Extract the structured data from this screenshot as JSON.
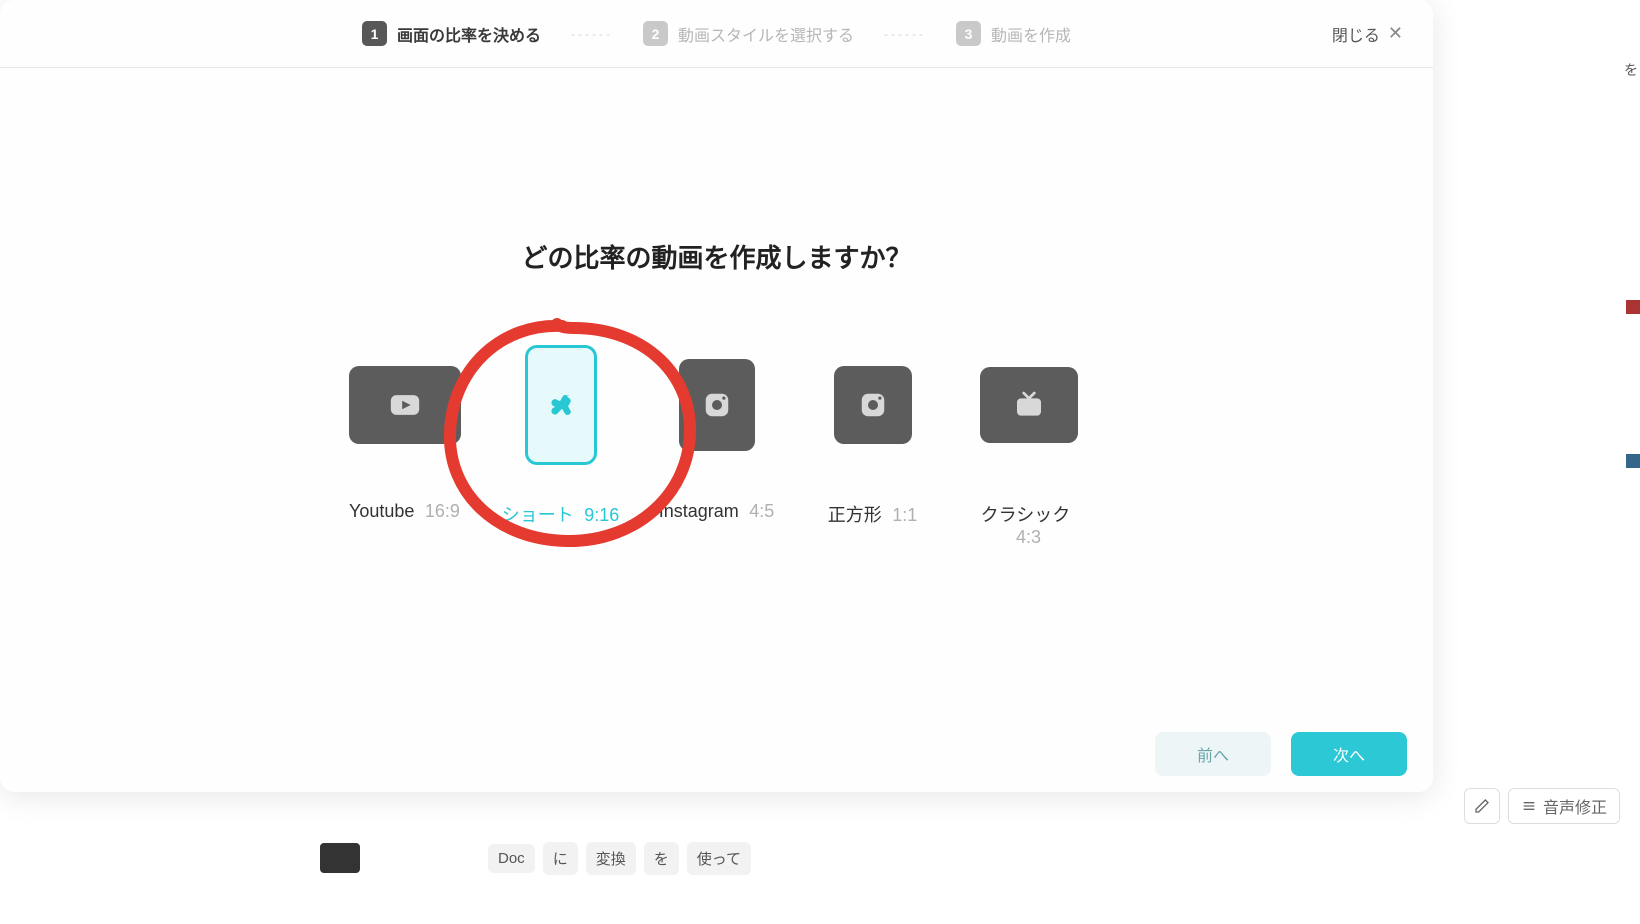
{
  "stepper": {
    "steps": [
      {
        "num": "1",
        "label": "画面の比率を決める",
        "active": true
      },
      {
        "num": "2",
        "label": "動画スタイルを選択する",
        "active": false
      },
      {
        "num": "3",
        "label": "動画を作成",
        "active": false
      }
    ],
    "close": "閉じる"
  },
  "main": {
    "question": "どの比率の動画を作成しますか？",
    "options": [
      {
        "name": "Youtube",
        "ratio": "16:9",
        "icon": "youtube",
        "selected": false
      },
      {
        "name": "ショート",
        "ratio": "9:16",
        "icon": "shorts",
        "selected": true
      },
      {
        "name": "Instagram",
        "ratio": "4:5",
        "icon": "instagram",
        "selected": false
      },
      {
        "name": "正方形",
        "ratio": "1:1",
        "icon": "instagram",
        "selected": false
      },
      {
        "name": "クラシック",
        "ratio": "4:3",
        "icon": "tv",
        "selected": false
      }
    ]
  },
  "footer": {
    "prev": "前へ",
    "next": "次へ"
  },
  "annotation": {
    "color": "#e53a2f",
    "target": "shorts"
  },
  "background": {
    "chips": [
      "Doc",
      "に",
      "変換",
      "を",
      "使って"
    ],
    "right_button": "音声修正",
    "right_sidebar_char": "を"
  }
}
